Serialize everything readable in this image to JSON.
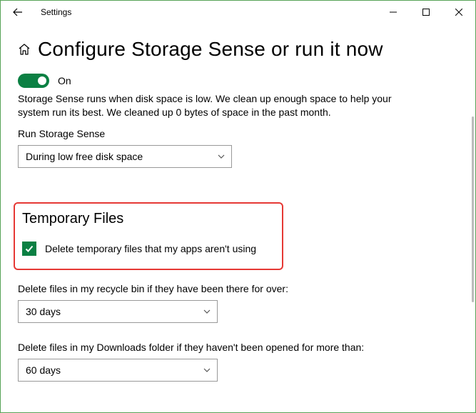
{
  "titlebar": {
    "title": "Settings"
  },
  "page": {
    "heading": "Configure Storage Sense or run it now"
  },
  "storage_sense": {
    "toggle_state": "On",
    "description": "Storage Sense runs when disk space is low. We clean up enough space to help your system run its best. We cleaned up 0 bytes of space in the past month.",
    "run_label": "Run Storage Sense",
    "run_dropdown_value": "During low free disk space"
  },
  "temp_files": {
    "section_heading": "Temporary Files",
    "checkbox_label": "Delete temporary files that my apps aren't using",
    "recycle_label": "Delete files in my recycle bin if they have been there for over:",
    "recycle_dropdown_value": "30 days",
    "downloads_label": "Delete files in my Downloads folder if they haven't been opened for more than:",
    "downloads_dropdown_value": "60 days"
  },
  "colors": {
    "accent_green": "#0b8043",
    "highlight_red": "#e63935"
  }
}
